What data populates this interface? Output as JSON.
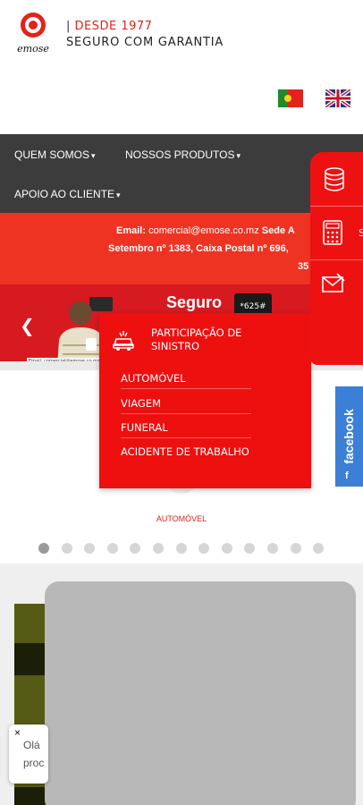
{
  "header": {
    "logo_text": "emose",
    "since": "DESDE 1977",
    "separator": "|",
    "slogan": "SEGURO COM GARANTIA"
  },
  "languages": [
    {
      "name": "pt-flag-icon"
    },
    {
      "name": "uk-flag-icon"
    }
  ],
  "nav": {
    "items": [
      "QUEM SOMOS",
      "NOSSOS PRODUTOS",
      "APOIO AO CLIENTE"
    ],
    "caret": "▾"
  },
  "info_band": {
    "email_label": "Email:",
    "email_value": "comercial@emose.co.mz",
    "sede_label": "Sede A",
    "line2": "Setembro nº 1383, Caixa Postal nº 696,",
    "line3": "35"
  },
  "banner": {
    "prev": "❮",
    "title": "Seguro",
    "code": "*625#",
    "fine_print": "Email: comercial@emose.co.mz"
  },
  "dropdown": {
    "heading": "PARTICIPAÇÃO DE SINISTRO",
    "items": [
      "AUTOMÓVEL",
      "VIAGEM",
      "FUNERAL",
      "ACIDENTE DE TRABALHO"
    ]
  },
  "carousel": {
    "label": "AUTOMÓVEL",
    "dot_count": 13,
    "active_index": 0
  },
  "side_menu": {
    "letter": "S"
  },
  "facebook": {
    "label": "facebook",
    "short": "f"
  },
  "chat": {
    "close": "×",
    "text1": "Olá",
    "text2": "proc"
  },
  "colors": {
    "brand_red": "#ee3322",
    "nav_bg": "#3c3c3c",
    "dropdown_red": "#ee0f0f",
    "facebook_blue": "#3b7fd6"
  }
}
